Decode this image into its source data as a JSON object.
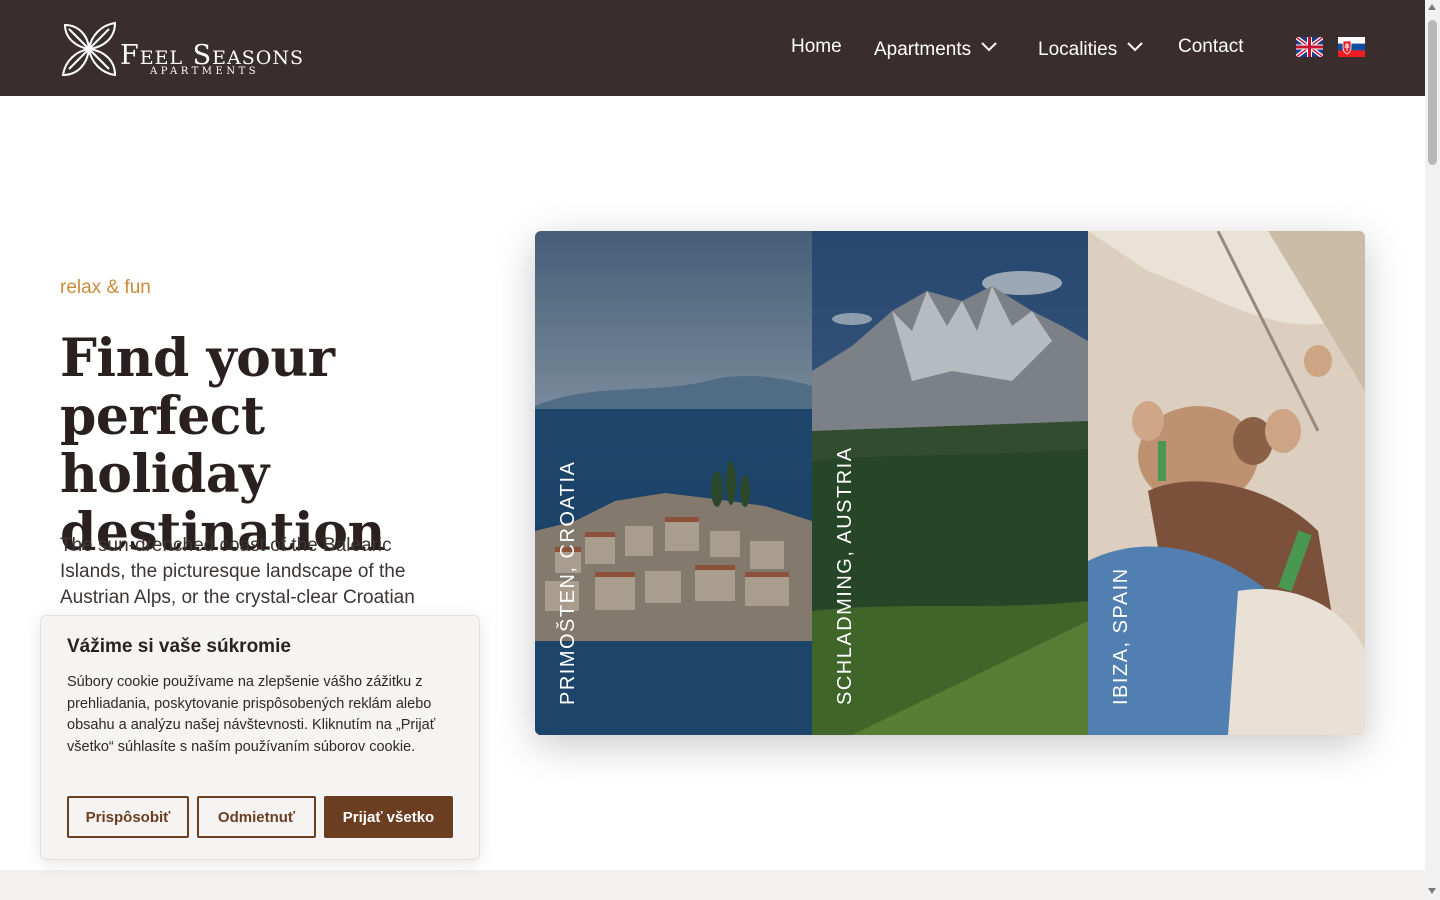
{
  "header": {
    "logo_title": "Feel Seasons",
    "logo_subtitle": "APARTMENTS",
    "nav": {
      "home": "Home",
      "apartments": "Apartments",
      "localities": "Localities",
      "contact": "Contact"
    },
    "languages": [
      "English",
      "Slovak"
    ]
  },
  "hero": {
    "tagline": "relax & fun",
    "headline": "Find your perfect holiday destination",
    "paragraph": "The sun-drenched coast of the Balearic Islands, the picturesque landscape of the Austrian Alps, or the crystal-clear Croatian"
  },
  "destinations": [
    {
      "label": "PRIMOŠTEN, CROATIA"
    },
    {
      "label": "SCHLADMING, AUSTRIA"
    },
    {
      "label": "IBIZA, SPAIN"
    }
  ],
  "cookie": {
    "title": "Vážime si vaše súkromie",
    "text": "Súbory cookie používame na zlepšenie vášho zážitku z prehliadania, poskytovanie prispôsobených reklám alebo obsahu a analýzu našej návštevnosti. Kliknutím na „Prijať všetko“ súhlasíte s naším používaním súborov cookie.",
    "customize": "Prispôsobiť",
    "reject": "Odmietnuť",
    "accept": "Prijať všetko"
  },
  "colors": {
    "header_bg": "#3a2d2d",
    "accent": "#c98a3c",
    "button_brown": "#6b3e22"
  }
}
